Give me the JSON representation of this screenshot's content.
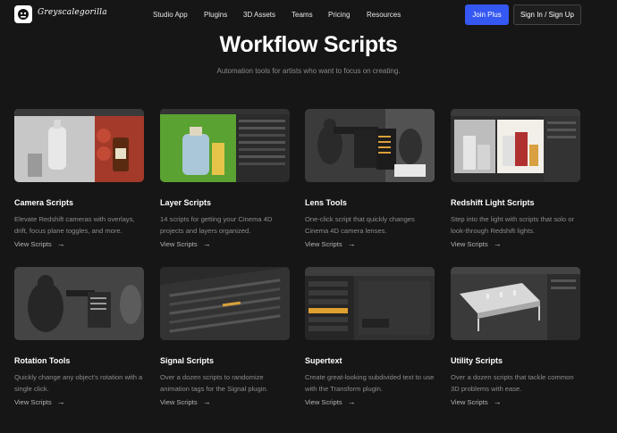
{
  "nav": {
    "logo_text": "Greyscalegorilla",
    "links": [
      "Studio App",
      "Plugins",
      "3D Assets",
      "Teams",
      "Pricing",
      "Resources"
    ],
    "join_label": "Join Plus",
    "sign_label": "Sign In / Sign Up"
  },
  "hero": {
    "title": "Workflow Scripts",
    "subtitle": "Automation tools for artists who want to focus on creating."
  },
  "cards": [
    {
      "title": "Camera Scripts",
      "desc": "Elevate Redshift cameras with overlays, drift, focus plane toggles, and more.",
      "link": "View Scripts"
    },
    {
      "title": "Layer Scripts",
      "desc": "14 scripts for getting your Cinema 4D projects and layers organized.",
      "link": "View Scripts"
    },
    {
      "title": "Lens Tools",
      "desc": "One-click script that quickly changes Cinema 4D camera lenses.",
      "link": "View Scripts"
    },
    {
      "title": "Redshift Light Scripts",
      "desc": "Step into the light with scripts that solo or look-through Redshift lights.",
      "link": "View Scripts"
    },
    {
      "title": "Rotation Tools",
      "desc": "Quickly change any object's rotation with a single click.",
      "link": "View Scripts"
    },
    {
      "title": "Signal Scripts",
      "desc": "Over a dozen scripts to randomize animation tags for the Signal plugin.",
      "link": "View Scripts"
    },
    {
      "title": "Supertext",
      "desc": "Create great-looking subdivided text to use with the Transform plugin.",
      "link": "View Scripts"
    },
    {
      "title": "Utility Scripts",
      "desc": "Over a dozen scripts that tackle common 3D problems with ease.",
      "link": "View Scripts"
    }
  ],
  "colors": {
    "background": "#161616",
    "accent": "#3557f2",
    "muted_text": "#8c8c8c"
  }
}
